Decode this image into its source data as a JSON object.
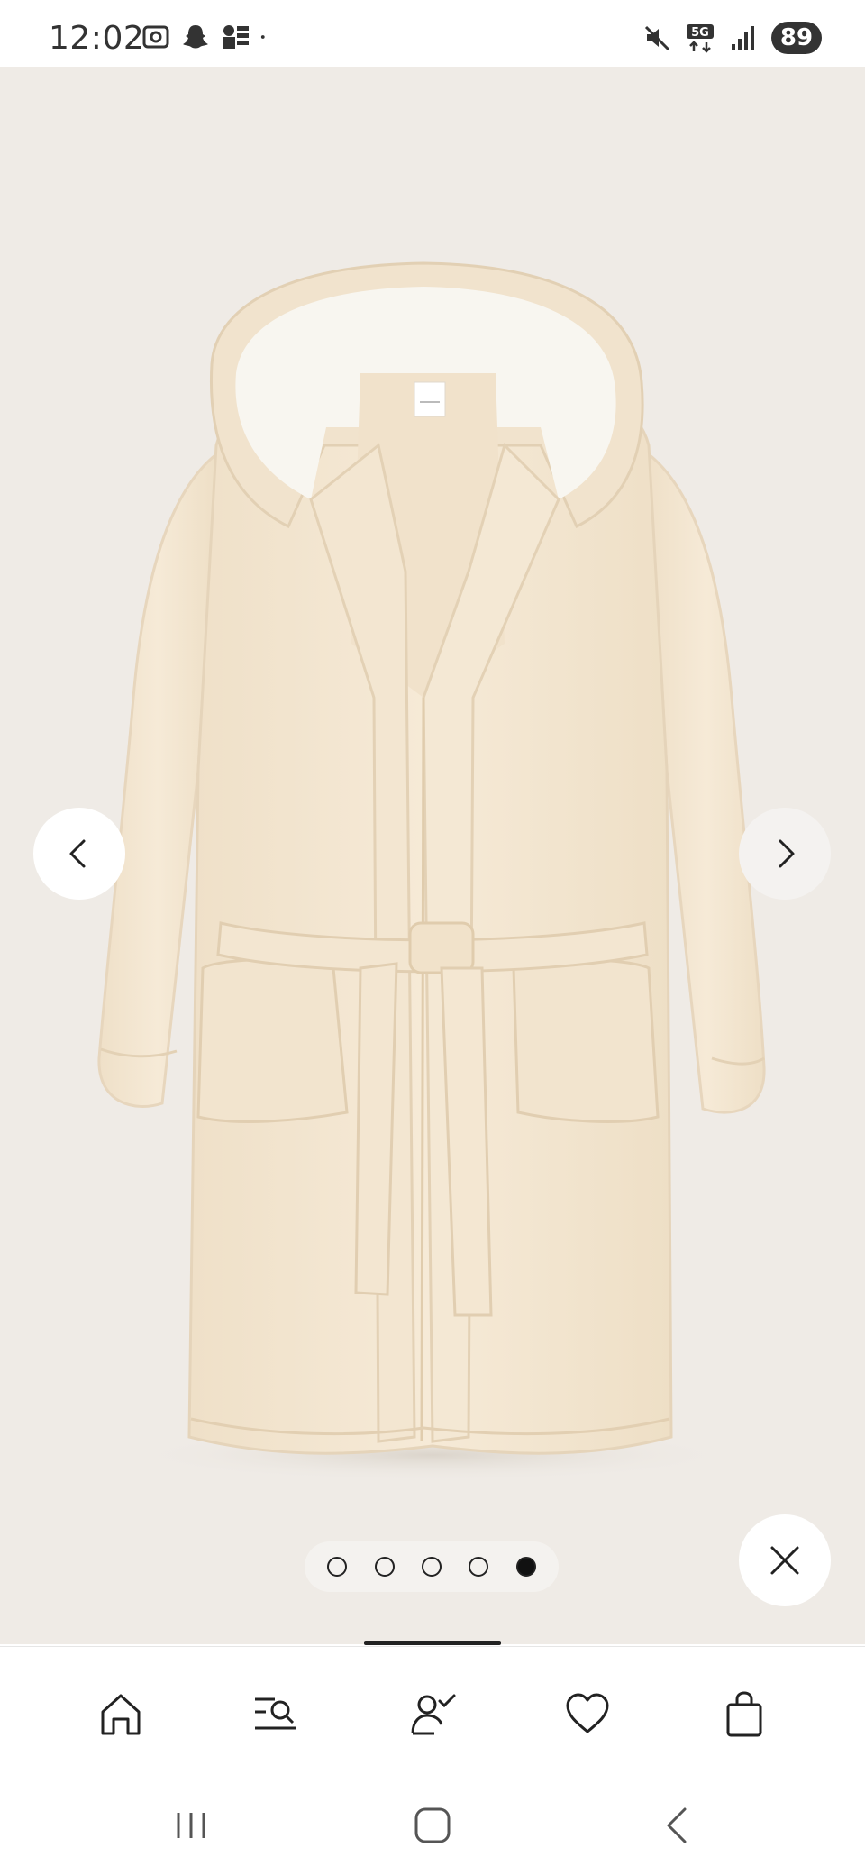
{
  "status_bar": {
    "time": "12:02",
    "battery": "89",
    "network": "5G",
    "icons_left": [
      "screenshot-icon",
      "snapchat-icon",
      "gallery-icon",
      "dot-icon"
    ],
    "icons_right": [
      "mute-icon",
      "5g-icon",
      "signal-icon",
      "battery-icon"
    ]
  },
  "gallery": {
    "image_description_icon": "bathrobe-image",
    "background_color": "#efebe6",
    "robe_color": "#f3e6d2",
    "hood_lining_color": "#f8f6f0",
    "dots": [
      {
        "active": false
      },
      {
        "active": false
      },
      {
        "active": false
      },
      {
        "active": false
      },
      {
        "active": true
      }
    ],
    "current_index": 5,
    "total": 5
  },
  "bottom_nav": {
    "tabs": [
      {
        "name": "home",
        "icon": "home-icon"
      },
      {
        "name": "search",
        "icon": "search-list-icon"
      },
      {
        "name": "account",
        "icon": "account-check-icon"
      },
      {
        "name": "favorites",
        "icon": "heart-icon"
      },
      {
        "name": "bag",
        "icon": "shopping-bag-icon"
      }
    ]
  },
  "system_nav": {
    "buttons": [
      "recents-icon",
      "home-icon",
      "back-icon"
    ]
  }
}
